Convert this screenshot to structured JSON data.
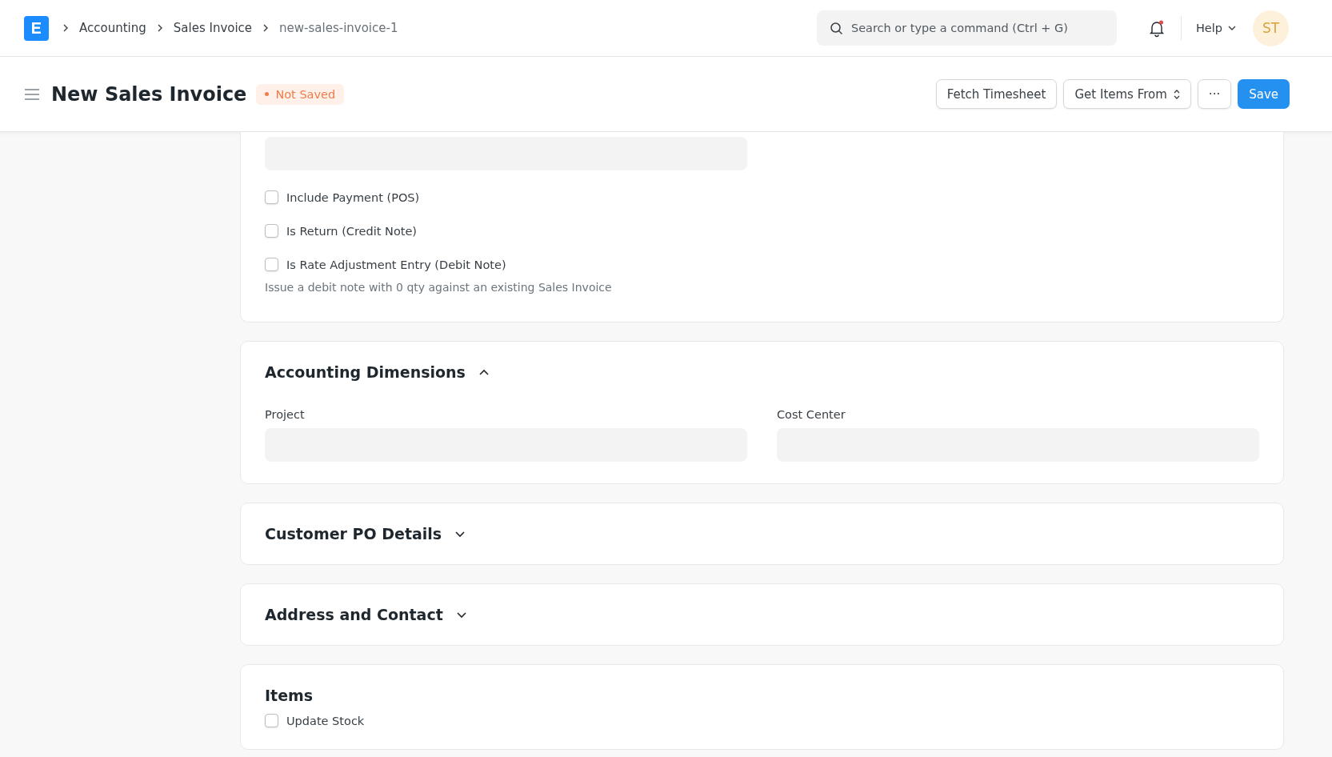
{
  "navbar": {
    "breadcrumbs": [
      {
        "label": "Accounting",
        "current": false
      },
      {
        "label": "Sales Invoice",
        "current": false
      },
      {
        "label": "new-sales-invoice-1",
        "current": true
      }
    ],
    "search": {
      "placeholder": "Search or type a command (Ctrl + G)"
    },
    "notifications": {
      "unread": true
    },
    "help": "Help",
    "avatar": "ST"
  },
  "page_header": {
    "title": "New Sales Invoice",
    "status": "Not Saved",
    "buttons": [
      {
        "label": "Fetch Timesheet",
        "kind": "default"
      },
      {
        "label": "Get Items From",
        "kind": "select"
      },
      {
        "label": "···",
        "kind": "more"
      },
      {
        "label": "Save",
        "kind": "primary"
      }
    ]
  },
  "sections": [
    {
      "fields": [
        {
          "kind": "input"
        },
        {
          "kind": "check",
          "label": "Include Payment (POS)",
          "checked": false
        },
        {
          "kind": "check",
          "label": "Is Return (Credit Note)",
          "checked": false
        },
        {
          "kind": "check",
          "label": "Is Rate Adjustment Entry (Debit Note)",
          "checked": false,
          "description": "Issue a debit note with 0 qty against an existing Sales Invoice"
        }
      ]
    },
    {
      "title": "Accounting Dimensions",
      "expanded": true,
      "columns": [
        {
          "label": "Project"
        },
        {
          "label": "Cost Center"
        }
      ]
    },
    {
      "title": "Customer PO Details",
      "expanded": false
    },
    {
      "title": "Address and Contact",
      "expanded": false
    },
    {
      "title": "Items",
      "fields": [
        {
          "kind": "check",
          "label": "Update Stock",
          "checked": false
        }
      ]
    }
  ]
}
